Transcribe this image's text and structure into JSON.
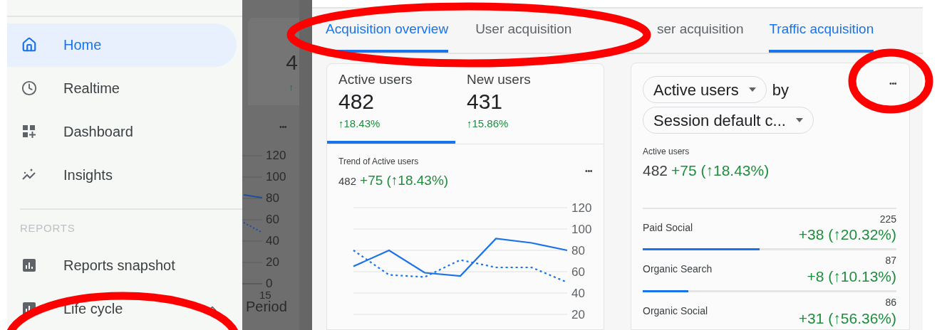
{
  "sidebar": {
    "items": [
      {
        "label": "Home",
        "selected": true
      },
      {
        "label": "Realtime",
        "selected": false
      },
      {
        "label": "Dashboard",
        "selected": false
      },
      {
        "label": "Insights",
        "selected": false
      }
    ],
    "section": "REPORTS",
    "report_items": [
      {
        "label": "Reports snapshot",
        "selected": false
      },
      {
        "label": "Life cycle",
        "selected": false,
        "expanded": true
      }
    ]
  },
  "dimmed_panel": {
    "value": "4",
    "arrow": "↑",
    "menu": "•••",
    "y_ticks": [
      "120",
      "100",
      "80",
      "60",
      "40",
      "20",
      "0"
    ],
    "x_tick": "15",
    "axis_title": "Period"
  },
  "overview_panel": {
    "tabs": [
      {
        "label": "Acquisition overview",
        "selected": true
      },
      {
        "label": "User acquisition",
        "selected": false
      }
    ],
    "metrics": [
      {
        "label": "Active users",
        "value": "482",
        "change": "↑18.43%",
        "selected": true
      },
      {
        "label": "New users",
        "value": "431",
        "change": "↑15.86%",
        "selected": false
      }
    ],
    "trend": {
      "title": "Trend of Active users",
      "value": "482",
      "delta": "+75 (↑18.43%)",
      "menu": "•••",
      "chart_data": {
        "type": "line",
        "grid": true,
        "ylim": [
          20,
          120
        ],
        "yticks": [
          20,
          40,
          60,
          80,
          100,
          120
        ],
        "series": [
          {
            "color": "#1a73e8",
            "line_style": "solid",
            "values": [
              65,
              80,
              59,
              56,
              91,
              87,
              80
            ]
          },
          {
            "color": "#1a73e8",
            "line_style": "dotted",
            "values": [
              80,
              57,
              55,
              71,
              64,
              64,
              50
            ]
          }
        ]
      }
    }
  },
  "traffic_panel": {
    "tabs": [
      {
        "label": "ser acquisition",
        "selected": false
      },
      {
        "label": "Traffic acquisition",
        "selected": true
      }
    ],
    "metric_chip": "Active users",
    "by": "by",
    "dimension_chip": "Session default c...",
    "menu": "•••",
    "summary_label": "Active users",
    "summary_value": "482",
    "summary_delta": "+75 (↑18.43%)",
    "rows": [
      {
        "name": "Paid Social",
        "value": "225",
        "delta": "+38 (↑20.32%)",
        "level": 0.46
      },
      {
        "name": "Organic Search",
        "value": "87",
        "delta": "+8 (↑10.13%)",
        "level": 0.18
      },
      {
        "name": "Organic Social",
        "value": "86",
        "delta": "+31 (↑56.36%)"
      }
    ]
  },
  "annotations": [
    {
      "kind": "ellipse",
      "color": "#ff0000"
    },
    {
      "kind": "ellipse",
      "color": "#ff0000"
    },
    {
      "kind": "ellipse",
      "color": "#ff0000"
    }
  ]
}
